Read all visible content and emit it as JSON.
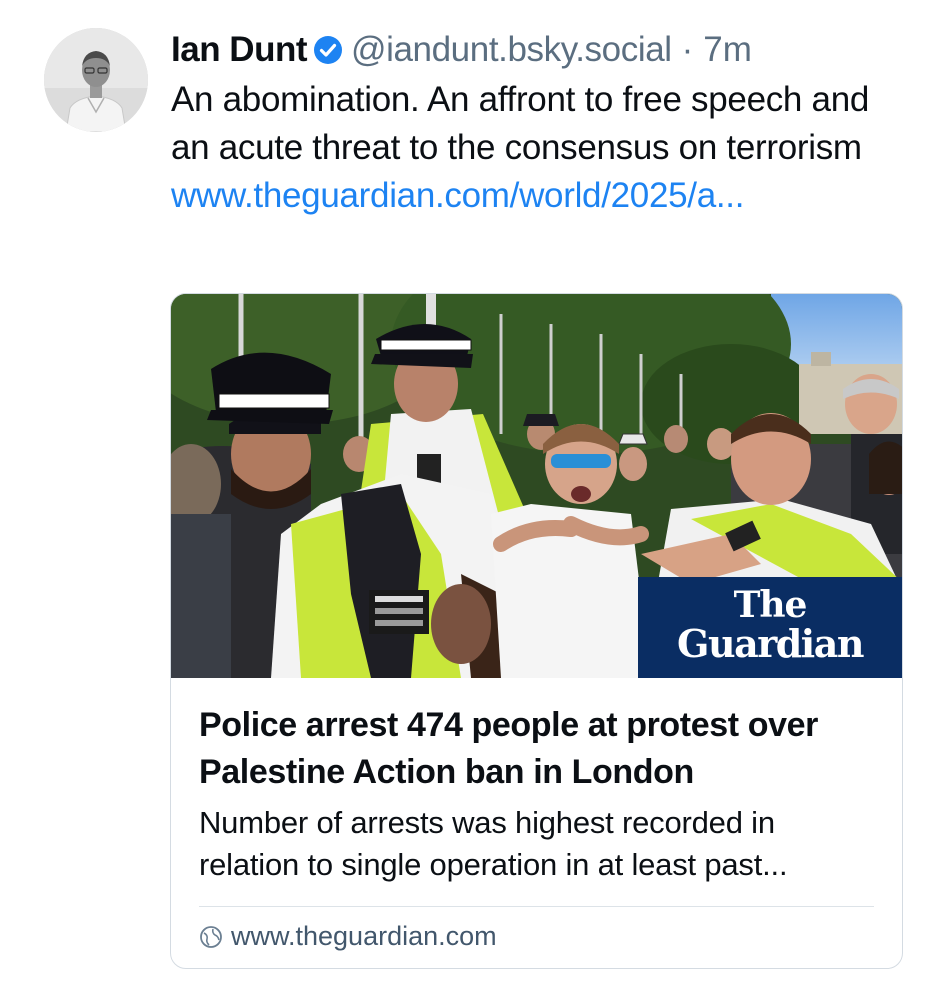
{
  "post": {
    "author": {
      "display_name": "Ian Dunt",
      "handle": "@iandunt.bsky.social",
      "verified": true
    },
    "separator": "·",
    "timestamp": "7m",
    "text": "An abomination. An affront to free speech and an acute threat to the consensus on terrorism",
    "link_text": "www.theguardian.com/world/2025/a..."
  },
  "link_card": {
    "image_brand_line1": "The",
    "image_brand_line2": "Guardian",
    "title": "Police arrest 474 people at protest over Palestine Action ban in London",
    "description": "Number of arrests was highest recorded in relation to single operation in at least past...",
    "domain": "www.theguardian.com"
  },
  "colors": {
    "link": "#1d83f2",
    "secondary_text": "#5b6e80",
    "verified_badge": "#1d83f2",
    "guardian_brand": "#0a2d63",
    "police_vest": "#c8e63a"
  },
  "icons": {
    "verified": "verified-badge-icon",
    "domain": "globe-icon"
  }
}
